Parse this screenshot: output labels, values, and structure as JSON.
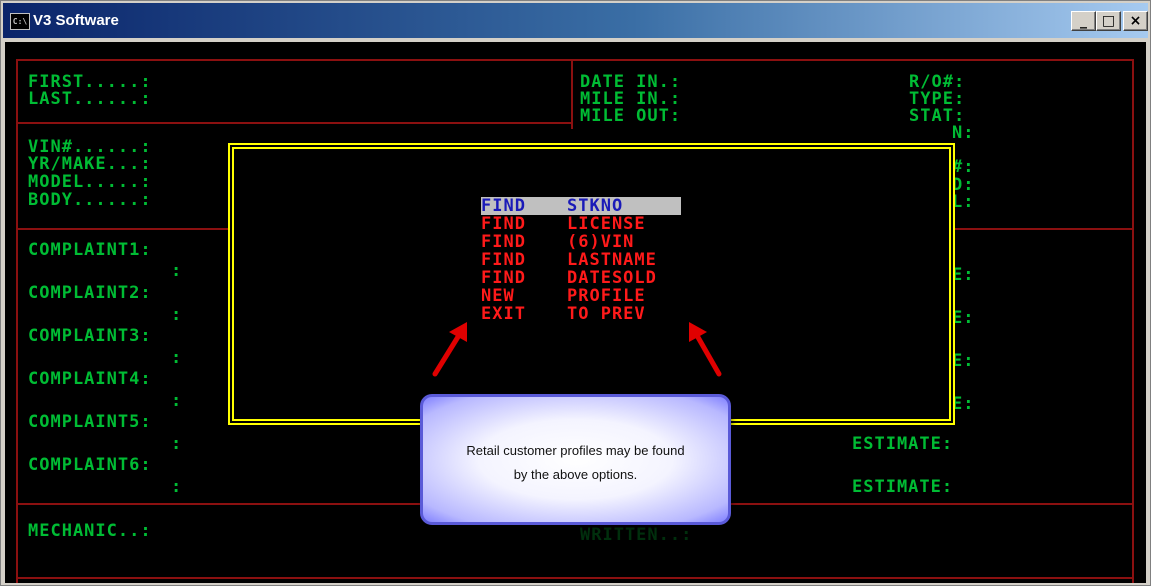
{
  "window": {
    "title": "V3 Software",
    "icon_label": "C:\\",
    "buttons": {
      "minimize": "_",
      "maximize": "□",
      "close": "×"
    }
  },
  "fields": {
    "first": "FIRST.....:",
    "last": "LAST......:",
    "vin": "VIN#......:",
    "yrmake": "YR/MAKE...:",
    "model": "MODEL.....:",
    "body": "BODY......:",
    "date_in": "DATE IN.:",
    "mile_in": "MILE IN.:",
    "mile_out": "MILE OUT:",
    "ro": "R/O#:",
    "type": "TYPE:",
    "stat": "STAT:",
    "partial_n": "N:",
    "partial_hash": "#:",
    "partial_d": "D:",
    "partial_l": "L:",
    "complaint1": "COMPLAINT1:",
    "complaint2": "COMPLAINT2:",
    "complaint3": "COMPLAINT3:",
    "complaint4": "COMPLAINT4:",
    "complaint5": "COMPLAINT5:",
    "complaint6": "COMPLAINT6:",
    "colon": ":",
    "partial_e": "E:",
    "estimate": "ESTIMATE:",
    "mechanic": "MECHANIC..:",
    "written": "WRITTEN..:"
  },
  "menu": {
    "items": [
      {
        "action": "FIND",
        "target": "STKNO"
      },
      {
        "action": "FIND",
        "target": "LICENSE"
      },
      {
        "action": "FIND",
        "target": "(6)VIN"
      },
      {
        "action": "FIND",
        "target": "LASTNAME"
      },
      {
        "action": "FIND",
        "target": "DATESOLD"
      },
      {
        "action": "NEW",
        "target": "PROFILE"
      },
      {
        "action": "EXIT",
        "target": "TO PREV"
      }
    ],
    "selected_index": 0
  },
  "callout": {
    "line1": "Retail customer profiles may be found",
    "line2": "by the above options."
  },
  "colors": {
    "field_text": "#00bc34",
    "menu_text": "#ff1a1a",
    "border_red": "#8b1010",
    "menu_border": "#ffff00",
    "selected_bg": "#c0c0c0",
    "selected_text": "#1a1ab8",
    "arrow": "#e00000"
  }
}
